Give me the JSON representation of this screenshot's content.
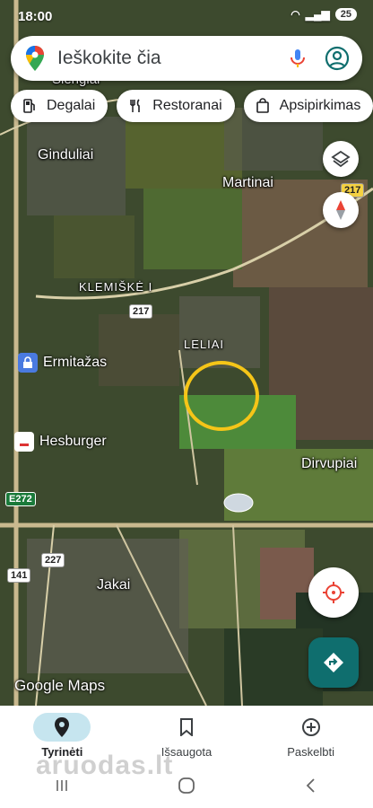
{
  "status": {
    "time": "18:00",
    "battery": "25"
  },
  "search": {
    "placeholder": "Ieškokite čia"
  },
  "chips": [
    {
      "label": "Degalai",
      "icon": "gas-station-icon"
    },
    {
      "label": "Restoranai",
      "icon": "restaurant-icon"
    },
    {
      "label": "Apsipirkimas",
      "icon": "shopping-bag-icon"
    }
  ],
  "map": {
    "places": {
      "top": "Slengiai",
      "gindulai": "Ginduliai",
      "martinai": "Martinai",
      "klemiske": "KLEMIŠKĖ I",
      "leliai": "LELIAI",
      "dirvupiai": "Dirvupiai",
      "jakai": "Jakai"
    },
    "pois": {
      "ermitazas": "Ermitažas",
      "hesburger": "Hesburger"
    },
    "roads": {
      "r217a": "217",
      "r217b": "217",
      "e272": "E272",
      "r227": "227",
      "r141": "141"
    },
    "attribution": "Google Maps"
  },
  "bottom_nav": [
    {
      "label": "Tyrinėti",
      "icon": "explore-pin-icon",
      "active": true
    },
    {
      "label": "Išsaugota",
      "icon": "bookmark-icon",
      "active": false
    },
    {
      "label": "Paskelbti",
      "icon": "add-circle-icon",
      "active": false
    }
  ],
  "watermark": "aruodas.lt",
  "colors": {
    "accent": "#0f6e6e",
    "highlight": "#f5c518",
    "active_nav": "#c6e5ef"
  }
}
